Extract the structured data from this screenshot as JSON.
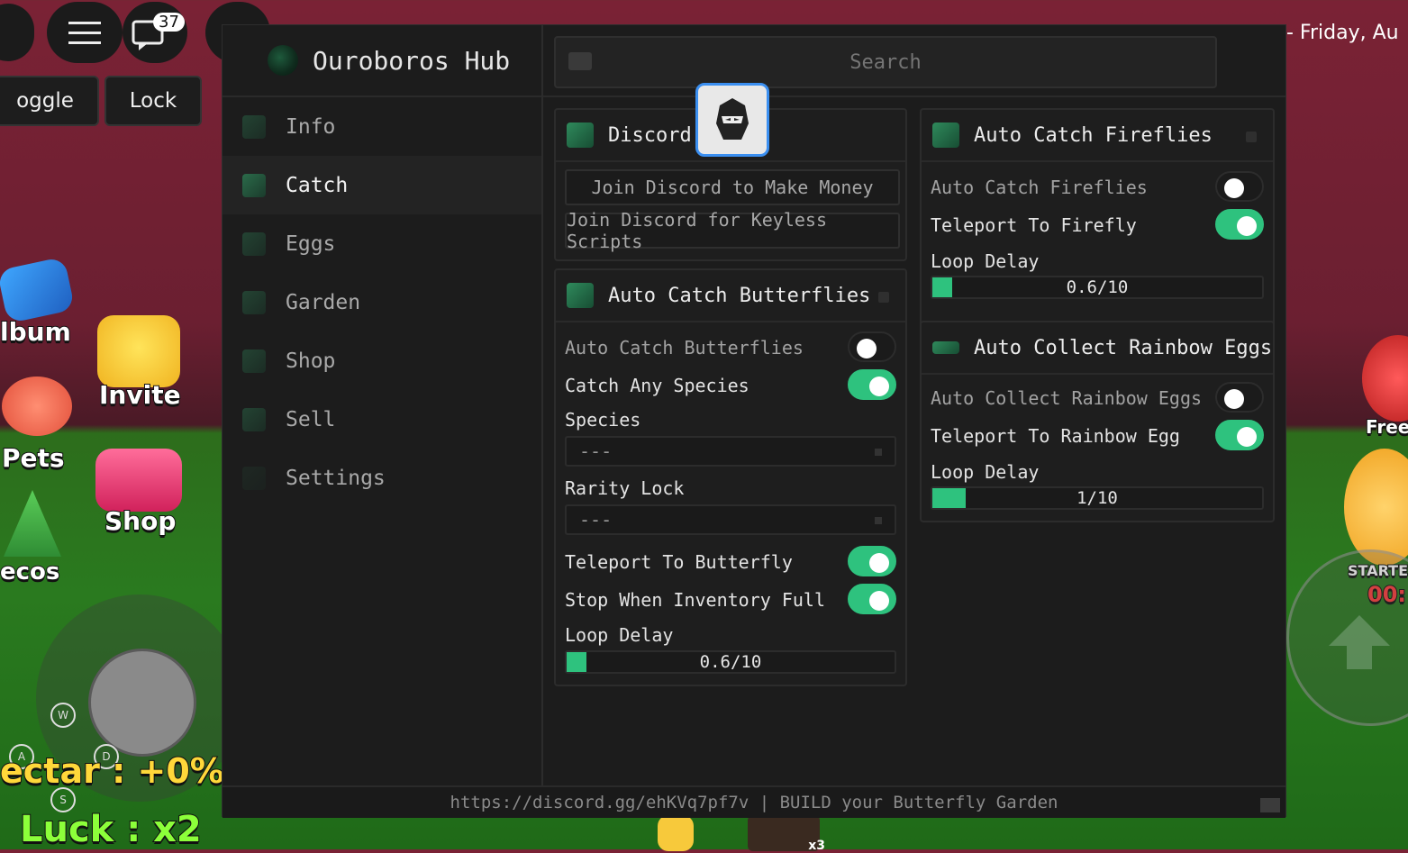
{
  "game": {
    "datetime": "- Friday, Au",
    "chat_badge": "37",
    "toggle_label": "oggle",
    "lock_label": "Lock",
    "album_label": "lbum",
    "invite_label": "Invite",
    "pets_label": "Pets",
    "shop_label": "Shop",
    "decos_label": "ecos",
    "free_label": "Free",
    "starter_label": "STARTE",
    "timer_label": "00:",
    "nectar_label": "ectar : +0%",
    "luck_label": "Luck : x2",
    "hotbar_count": "x3",
    "keys": {
      "w": "W",
      "a": "A",
      "s": "S",
      "d": "D"
    }
  },
  "hub": {
    "title": "Ouroboros Hub",
    "search_placeholder": "Search",
    "footer": "https://discord.gg/ehKVq7pf7v | BUILD your Butterfly Garden",
    "nav": [
      {
        "label": "Info",
        "active": false
      },
      {
        "label": "Catch",
        "active": true
      },
      {
        "label": "Eggs",
        "active": false
      },
      {
        "label": "Garden",
        "active": false
      },
      {
        "label": "Shop",
        "active": false
      },
      {
        "label": "Sell",
        "active": false
      },
      {
        "label": "Settings",
        "active": false
      }
    ]
  },
  "discord": {
    "title": "Discord",
    "btn_money": "Join Discord to Make Money",
    "btn_keyless": "Join Discord for Keyless Scripts"
  },
  "butterflies": {
    "title": "Auto Catch Butterflies",
    "toggle_auto": {
      "label": "Auto Catch Butterflies",
      "on": false
    },
    "toggle_any": {
      "label": "Catch Any Species",
      "on": true
    },
    "species_label": "Species",
    "species_value": "---",
    "rarity_label": "Rarity Lock",
    "rarity_value": "---",
    "toggle_teleport": {
      "label": "Teleport To Butterfly",
      "on": true
    },
    "toggle_stop": {
      "label": "Stop When Inventory Full",
      "on": true
    },
    "delay_label": "Loop Delay",
    "delay_value": "0.6/10",
    "delay_fraction": 0.06
  },
  "fireflies": {
    "title": "Auto Catch Fireflies",
    "toggle_auto": {
      "label": "Auto Catch Fireflies",
      "on": false
    },
    "toggle_teleport": {
      "label": "Teleport To Firefly",
      "on": true
    },
    "delay_label": "Loop Delay",
    "delay_value": "0.6/10",
    "delay_fraction": 0.06
  },
  "rainbow": {
    "title": "Auto Collect Rainbow Eggs",
    "toggle_auto": {
      "label": "Auto Collect Rainbow Eggs",
      "on": false
    },
    "toggle_teleport": {
      "label": "Teleport To Rainbow Egg",
      "on": true
    },
    "delay_label": "Loop Delay",
    "delay_value": "1/10",
    "delay_fraction": 0.1
  },
  "colors": {
    "accent": "#2ec27e",
    "panel": "#1c1c1c",
    "highlight": "#3b8ff0"
  }
}
